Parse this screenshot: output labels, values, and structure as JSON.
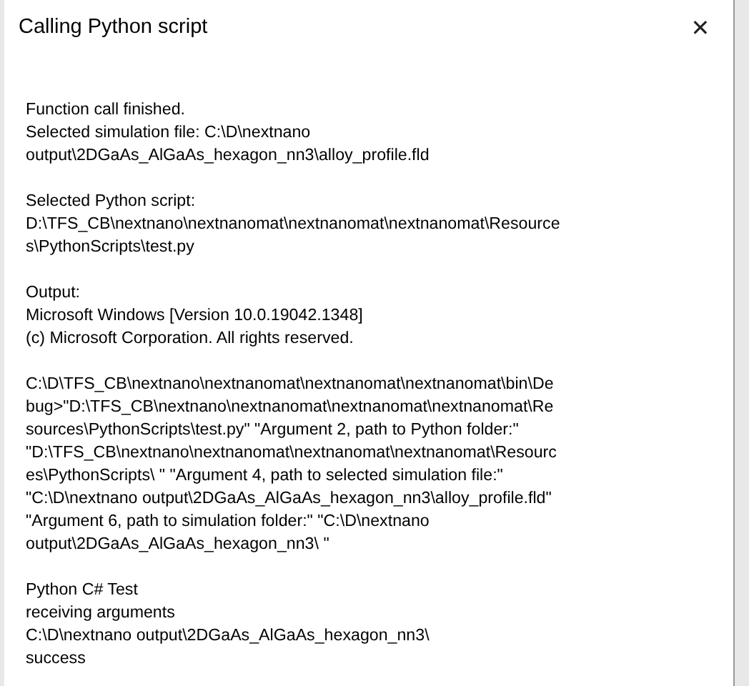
{
  "window": {
    "title": "Calling Python script",
    "close": "✕"
  },
  "paragraphs": [
    [
      "Function call finished.",
      "Selected simulation file: C:\\D\\nextnano",
      "output\\2DGaAs_AlGaAs_hexagon_nn3\\alloy_profile.fld"
    ],
    [
      "Selected Python script:",
      "D:\\TFS_CB\\nextnano\\nextnanomat\\nextnanomat\\nextnanomat\\Resource",
      "s\\PythonScripts\\test.py"
    ],
    [
      "Output:",
      "Microsoft Windows [Version 10.0.19042.1348]",
      "(c) Microsoft Corporation. All rights reserved."
    ],
    [
      "C:\\D\\TFS_CB\\nextnano\\nextnanomat\\nextnanomat\\nextnanomat\\bin\\De",
      "bug>\"D:\\TFS_CB\\nextnano\\nextnanomat\\nextnanomat\\nextnanomat\\Re",
      "sources\\PythonScripts\\test.py\" \"Argument 2, path to Python folder:\"",
      "\"D:\\TFS_CB\\nextnano\\nextnanomat\\nextnanomat\\nextnanomat\\Resourc",
      "es\\PythonScripts\\ \" \"Argument 4, path to selected simulation file:\"",
      "\"C:\\D\\nextnano output\\2DGaAs_AlGaAs_hexagon_nn3\\alloy_profile.fld\"",
      "\"Argument 6, path to simulation folder:\" \"C:\\D\\nextnano",
      "output\\2DGaAs_AlGaAs_hexagon_nn3\\ \""
    ],
    [
      "Python C# Test",
      "receiving arguments",
      "C:\\D\\nextnano output\\2DGaAs_AlGaAs_hexagon_nn3\\",
      "success"
    ]
  ]
}
